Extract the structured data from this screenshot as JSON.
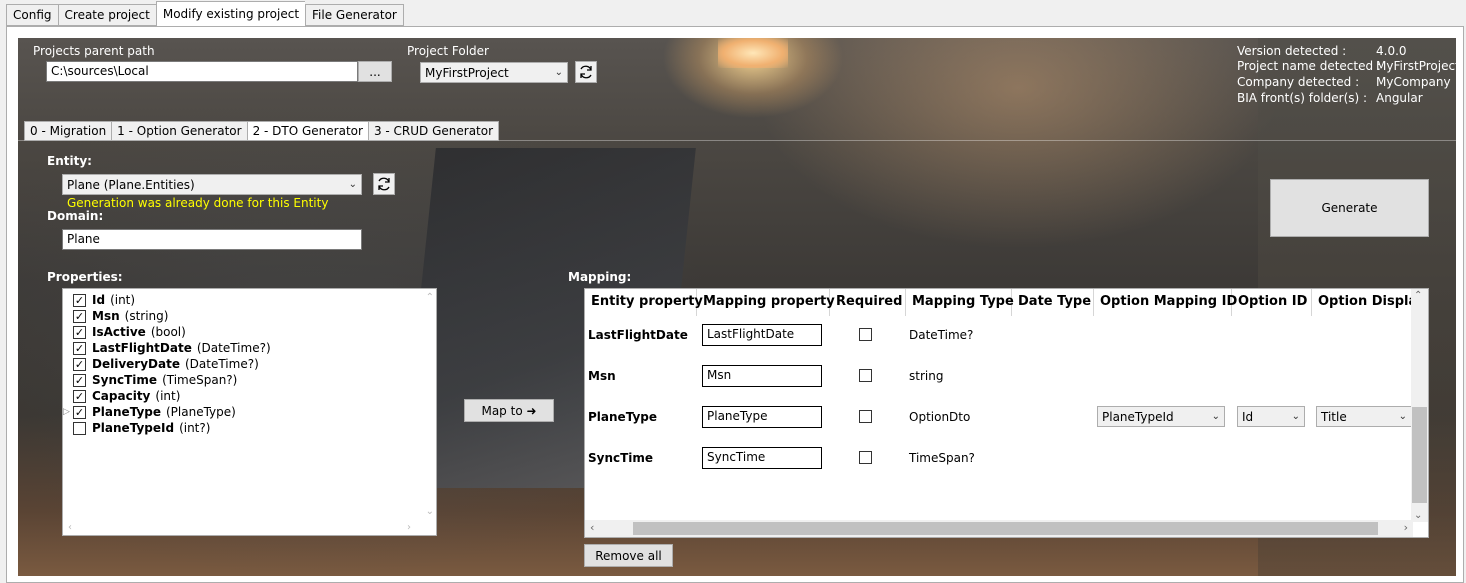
{
  "top_tabs": [
    "Config",
    "Create project",
    "Modify existing project",
    "File Generator"
  ],
  "project": {
    "parent_path_label": "Projects parent path",
    "parent_path_value": "C:\\sources\\Local",
    "browse_label": "...",
    "folder_label": "Project Folder",
    "folder_value": "MyFirstProject"
  },
  "detected": {
    "version_label": "Version detected :",
    "version_value": "4.0.0",
    "project_label": "Project name detected :",
    "project_value": "MyFirstProject",
    "company_label": "Company detected :",
    "company_value": "MyCompany",
    "front_label": "BIA front(s) folder(s) :",
    "front_value": "Angular"
  },
  "inner_tabs": [
    "0 - Migration",
    "1 - Option Generator",
    "2 - DTO Generator",
    "3 - CRUD Generator"
  ],
  "entity": {
    "label": "Entity:",
    "value": "Plane (Plane.Entities)",
    "warning": "Generation was already done for this Entity"
  },
  "domain": {
    "label": "Domain:",
    "value": "Plane"
  },
  "generate_label": "Generate",
  "properties": {
    "label": "Properties:",
    "items": [
      {
        "name": "Id",
        "type": "(int)",
        "checked": true
      },
      {
        "name": "Msn",
        "type": "(string)",
        "checked": true
      },
      {
        "name": "IsActive",
        "type": "(bool)",
        "checked": true
      },
      {
        "name": "LastFlightDate",
        "type": "(DateTime?)",
        "checked": true
      },
      {
        "name": "DeliveryDate",
        "type": "(DateTime?)",
        "checked": true
      },
      {
        "name": "SyncTime",
        "type": "(TimeSpan?)",
        "checked": true
      },
      {
        "name": "Capacity",
        "type": "(int)",
        "checked": true
      },
      {
        "name": "PlaneType",
        "type": "(PlaneType)",
        "checked": true
      },
      {
        "name": "PlaneTypeId",
        "type": "(int?)",
        "checked": false
      }
    ]
  },
  "map_to_label": "Map to ➜",
  "mapping": {
    "label": "Mapping:",
    "columns": [
      "Entity property",
      "Mapping property",
      "Required",
      "Mapping Type",
      "Date Type",
      "Option Mapping ID",
      "Option ID",
      "Option Display"
    ],
    "rows": [
      {
        "entity": "LastFlightDate",
        "mapping": "LastFlightDate",
        "type": "DateTime?",
        "option_mapping_id": "",
        "option_id": "",
        "option_display": ""
      },
      {
        "entity": "Msn",
        "mapping": "Msn",
        "type": "string",
        "option_mapping_id": "",
        "option_id": "",
        "option_display": ""
      },
      {
        "entity": "PlaneType",
        "mapping": "PlaneType",
        "type": "OptionDto",
        "option_mapping_id": "PlaneTypeId",
        "option_id": "Id",
        "option_display": "Title"
      },
      {
        "entity": "SyncTime",
        "mapping": "SyncTime",
        "type": "TimeSpan?",
        "option_mapping_id": "",
        "option_id": "",
        "option_display": ""
      }
    ]
  },
  "remove_all_label": "Remove all"
}
